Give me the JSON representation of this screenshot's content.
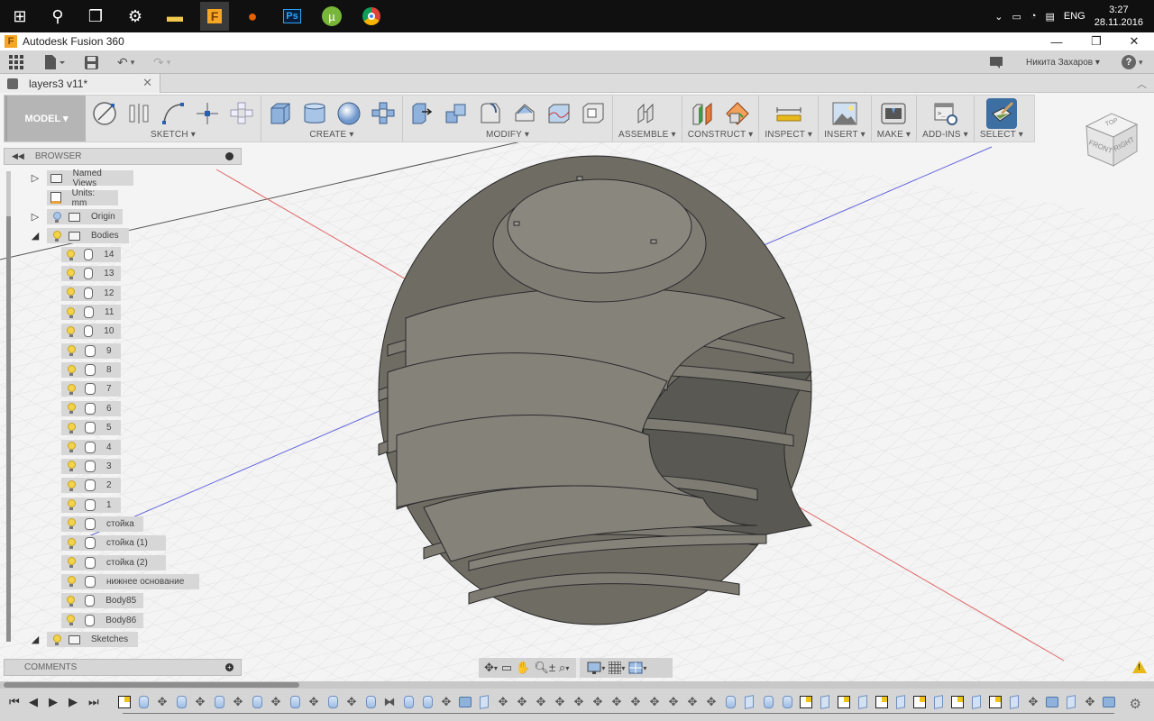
{
  "taskbar": {
    "apps": [
      {
        "name": "start",
        "glyph": "⊞"
      },
      {
        "name": "search",
        "glyph": "⚲"
      },
      {
        "name": "task-view",
        "glyph": "❐"
      },
      {
        "name": "settings",
        "glyph": "⚙"
      },
      {
        "name": "file-explorer",
        "glyph": "📁"
      },
      {
        "name": "fusion-360",
        "glyph": "F"
      },
      {
        "name": "firefox",
        "glyph": "●"
      },
      {
        "name": "photoshop",
        "glyph": "Ps"
      },
      {
        "name": "utorrent",
        "glyph": "µ"
      },
      {
        "name": "chrome",
        "glyph": "◉"
      }
    ],
    "language": "ENG",
    "time": "3:27",
    "date": "28.11.2016"
  },
  "window": {
    "title": "Autodesk Fusion 360",
    "minimize": "—",
    "restore": "❐",
    "close": "✕"
  },
  "quick_access": {
    "user_name": "Никита Захаров ▾",
    "help": "?"
  },
  "document_tab": {
    "name": "layers3 v11*",
    "close": "✕"
  },
  "ribbon": {
    "workspace": "MODEL ▾",
    "groups": [
      {
        "label": "SKETCH ▾"
      },
      {
        "label": "CREATE ▾"
      },
      {
        "label": "MODIFY ▾"
      },
      {
        "label": "ASSEMBLE ▾"
      },
      {
        "label": "CONSTRUCT ▾"
      },
      {
        "label": "INSPECT ▾"
      },
      {
        "label": "INSERT ▾"
      },
      {
        "label": "MAKE ▾"
      },
      {
        "label": "ADD-INS ▾"
      },
      {
        "label": "SELECT ▾"
      }
    ]
  },
  "viewcube": {
    "top": "TOP",
    "front": "FRONT",
    "right": "RIGHT"
  },
  "browser": {
    "title": "BROWSER",
    "named_views": "Named Views",
    "units": "Units: mm",
    "origin": "Origin",
    "bodies_folder": "Bodies",
    "bodies": [
      "14",
      "13",
      "12",
      "11",
      "10",
      "9",
      "8",
      "7",
      "6",
      "5",
      "4",
      "3",
      "2",
      "1",
      "стойка",
      "стойка (1)",
      "стойка (2)",
      "нижнее основание",
      "Body85",
      "Body86"
    ],
    "sketches": "Sketches"
  },
  "comments": {
    "title": "COMMENTS"
  },
  "colors": {
    "accent_select": "#3d6fa3",
    "model_fill": "#7a776f",
    "axis_x": "#e06666",
    "axis_y": "#6666dd"
  }
}
